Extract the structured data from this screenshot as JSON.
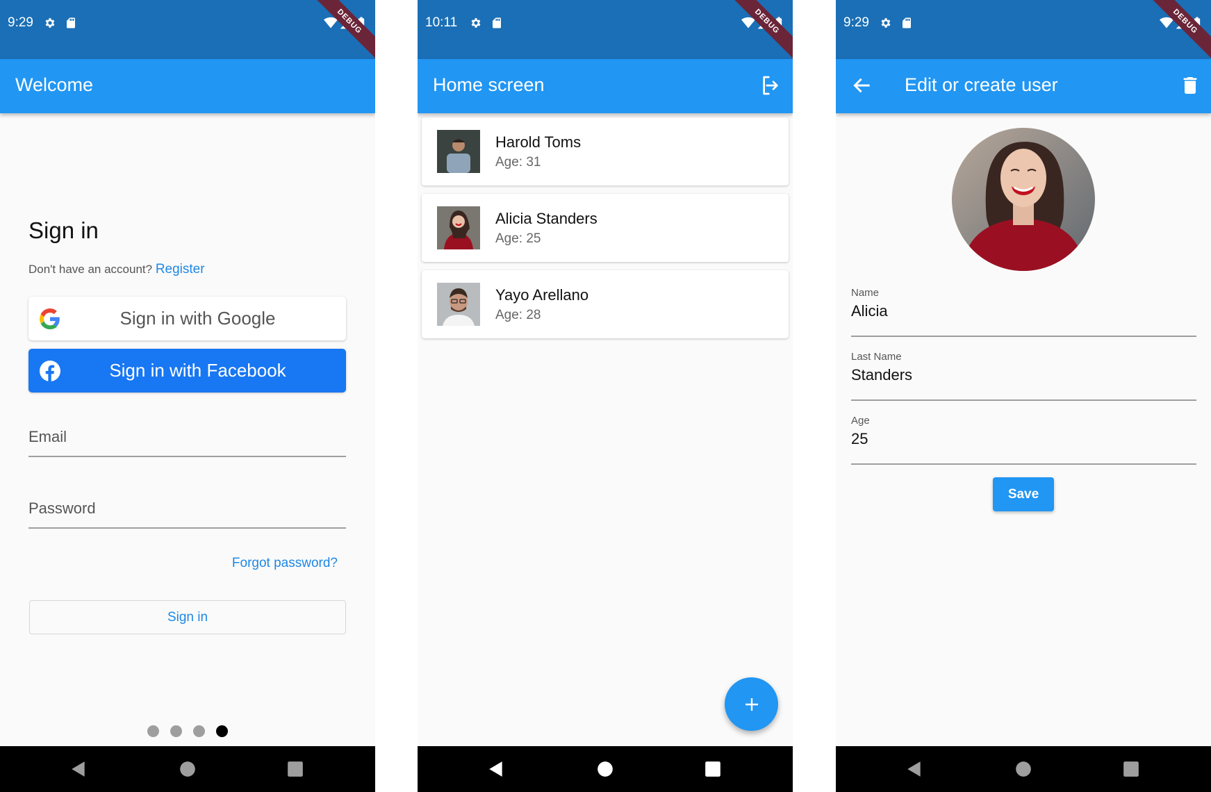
{
  "colors": {
    "status_bar": "#1a6fb6",
    "app_bar": "#2196f3",
    "link": "#1e88e5",
    "facebook": "#1877f2",
    "debug_banner": "#6b2538"
  },
  "screens": [
    {
      "status": {
        "time": "9:29",
        "debug_label": "DEBUG"
      },
      "app_bar": {
        "title": "Welcome"
      },
      "sign_in": {
        "title": "Sign in",
        "no_account_text": "Don't have an account?",
        "register_link": "Register",
        "google_button": "Sign in with Google",
        "facebook_button": "Sign in with Facebook",
        "email_placeholder": "Email",
        "password_placeholder": "Password",
        "forgot_password_link": "Forgot password?",
        "sign_in_button": "Sign in"
      },
      "page_indicator": {
        "count": 4,
        "active_index": 3
      },
      "nav_icons": [
        "back-icon",
        "home-icon",
        "recents-icon"
      ]
    },
    {
      "status": {
        "time": "10:11",
        "debug_label": "DEBUG"
      },
      "app_bar": {
        "title": "Home screen",
        "action_icon": "logout-icon"
      },
      "users": [
        {
          "name": "Harold Toms",
          "age_label": "Age: 31",
          "photo": "man-blue-shirt"
        },
        {
          "name": "Alicia Standers",
          "age_label": "Age: 25",
          "photo": "woman-red-sweater"
        },
        {
          "name": "Yayo Arellano",
          "age_label": "Age: 28",
          "photo": "man-glasses"
        }
      ],
      "fab": {
        "icon": "add-icon",
        "label": "+"
      }
    },
    {
      "status": {
        "time": "9:29",
        "debug_label": "DEBUG"
      },
      "app_bar": {
        "title": "Edit or create user",
        "leading_icon": "arrow-back-icon",
        "action_icon": "delete-icon"
      },
      "form": {
        "fields": [
          {
            "label": "Name",
            "value": "Alicia"
          },
          {
            "label": "Last Name",
            "value": "Standers"
          },
          {
            "label": "Age",
            "value": "25"
          }
        ],
        "save_button": "Save"
      }
    }
  ]
}
